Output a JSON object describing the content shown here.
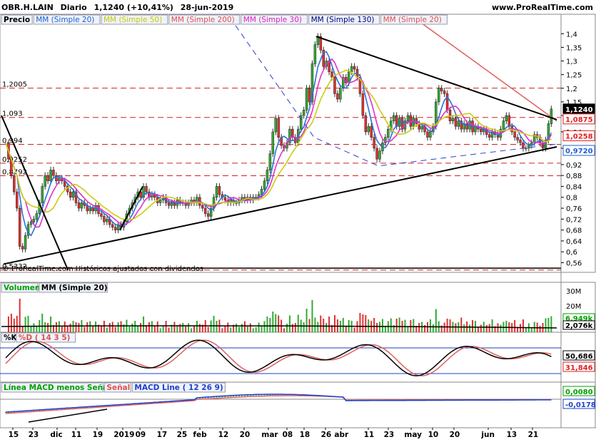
{
  "header": {
    "ticker": "OBR.H.LAIN",
    "period": "Diario",
    "last": "1,1240 (+10,41%)",
    "date": "28-jun-2019",
    "site": "www.ProRealTime.com"
  },
  "price_panel": {
    "legend": [
      {
        "label": "Precio",
        "color": "#000000"
      },
      {
        "label": "MM (Simple 20)",
        "color": "#1f5fd0"
      },
      {
        "label": "MM (Simple 50)",
        "color": "#c8c800"
      },
      {
        "label": "MM (Simple 200)",
        "color": "#e05050"
      },
      {
        "label": "MM (Simple 30)",
        "color": "#e020c0"
      },
      {
        "label": "MM (Simple 130)",
        "color": "#000080"
      },
      {
        "label": "MM (Simple 20)",
        "color": "#e05050"
      }
    ],
    "yticks": [
      "1,4",
      "1,35",
      "1,3",
      "1,25",
      "1,2",
      "1,15",
      "1,1",
      "1,04",
      "0,98",
      "0,92",
      "0,88",
      "0,84",
      "0,8",
      "0,76",
      "0,72",
      "0,68",
      "0,64",
      "0,6",
      "0,56"
    ],
    "hlines": [
      "1,2005",
      "1,093",
      "0,994",
      "0,9252",
      "0,8792",
      "0,5332"
    ],
    "right_labels": [
      {
        "text": "1,1240",
        "bg": "#000000",
        "fg": "#ffffff"
      },
      {
        "text": "1,0875",
        "bg": "#ffffff",
        "fg": "#e02020"
      },
      {
        "text": "1,0258",
        "bg": "#ffffff",
        "fg": "#e02020"
      },
      {
        "text": "0,9720",
        "bg": "#ffffff",
        "fg": "#1f5fd0"
      }
    ],
    "copyright": "© ProRealTime.com  Históricos ajustados con dividendos"
  },
  "volume_panel": {
    "legend": [
      {
        "label": "Volumen",
        "color": "#00a000"
      },
      {
        "label": "MM (Simple 20)",
        "color": "#000000"
      }
    ],
    "yticks": [
      "30M",
      "20M",
      "10M"
    ],
    "right_labels": [
      {
        "text": "6,949k",
        "fg": "#00a000"
      },
      {
        "text": "2,076k",
        "fg": "#000000"
      }
    ]
  },
  "stoch_panel": {
    "legend": [
      {
        "label": "%K",
        "color": "#000000"
      },
      {
        "label": "%D ( 14 3 5)",
        "color": "#e05050"
      }
    ],
    "right_labels": [
      {
        "text": "50,686",
        "fg": "#000000"
      },
      {
        "text": "31,846",
        "fg": "#e02020"
      }
    ]
  },
  "macd_panel": {
    "legend": [
      {
        "label": "Línea MACD menos Señal",
        "color": "#00a000"
      },
      {
        "label": "Señal",
        "color": "#e05050"
      },
      {
        "label": "MACD Line ( 12 26 9)",
        "color": "#1f3fd0"
      }
    ],
    "right_labels": [
      {
        "text": "0,0080",
        "fg": "#00a000"
      },
      {
        "text": "-0,0178",
        "fg": "#1f3fd0"
      }
    ]
  },
  "x_axis": {
    "labels": [
      "15",
      "23",
      "dic",
      "11",
      "19",
      "2019",
      "09",
      "17",
      "25",
      "feb",
      "12",
      "20",
      "mar",
      "08",
      "18",
      "26",
      "abr",
      "11",
      "23",
      "may",
      "10",
      "20",
      "jun",
      "13",
      "21"
    ]
  },
  "chart_data": {
    "type": "candlestick",
    "title": "OBR.H.LAIN Diario",
    "ylim": [
      0.53,
      1.44
    ],
    "hlines": [
      1.2005,
      1.093,
      0.994,
      0.9252,
      0.8792,
      0.5332
    ],
    "close_path": [
      [
        0,
        1.0
      ],
      [
        4,
        0.94
      ],
      [
        8,
        0.88
      ],
      [
        12,
        0.82
      ],
      [
        16,
        0.76
      ],
      [
        20,
        0.62
      ],
      [
        24,
        0.61
      ],
      [
        28,
        0.66
      ],
      [
        32,
        0.7
      ],
      [
        36,
        0.71
      ],
      [
        40,
        0.72
      ],
      [
        44,
        0.74
      ],
      [
        48,
        0.78
      ],
      [
        52,
        0.84
      ],
      [
        56,
        0.88
      ],
      [
        60,
        0.86
      ],
      [
        64,
        0.9
      ],
      [
        68,
        0.88
      ],
      [
        72,
        0.86
      ],
      [
        76,
        0.87
      ],
      [
        80,
        0.86
      ],
      [
        84,
        0.84
      ],
      [
        88,
        0.82
      ],
      [
        92,
        0.8
      ],
      [
        96,
        0.82
      ],
      [
        100,
        0.78
      ],
      [
        104,
        0.76
      ],
      [
        108,
        0.78
      ],
      [
        112,
        0.77
      ],
      [
        116,
        0.75
      ],
      [
        120,
        0.76
      ],
      [
        124,
        0.75
      ],
      [
        128,
        0.77
      ],
      [
        132,
        0.74
      ],
      [
        136,
        0.73
      ],
      [
        140,
        0.71
      ],
      [
        144,
        0.72
      ],
      [
        148,
        0.7
      ],
      [
        152,
        0.69
      ],
      [
        156,
        0.68
      ],
      [
        160,
        0.7
      ],
      [
        164,
        0.69
      ],
      [
        168,
        0.71
      ],
      [
        172,
        0.74
      ],
      [
        176,
        0.76
      ],
      [
        180,
        0.78
      ],
      [
        184,
        0.8
      ],
      [
        188,
        0.82
      ],
      [
        192,
        0.8
      ],
      [
        196,
        0.84
      ],
      [
        200,
        0.82
      ],
      [
        204,
        0.8
      ],
      [
        208,
        0.81
      ],
      [
        212,
        0.8
      ],
      [
        216,
        0.78
      ],
      [
        220,
        0.79
      ],
      [
        224,
        0.8
      ],
      [
        228,
        0.78
      ],
      [
        232,
        0.77
      ],
      [
        236,
        0.78
      ],
      [
        240,
        0.77
      ],
      [
        244,
        0.79
      ],
      [
        248,
        0.78
      ],
      [
        252,
        0.78
      ],
      [
        256,
        0.77
      ],
      [
        260,
        0.78
      ],
      [
        264,
        0.79
      ],
      [
        268,
        0.78
      ],
      [
        272,
        0.8
      ],
      [
        276,
        0.77
      ],
      [
        280,
        0.76
      ],
      [
        284,
        0.74
      ],
      [
        288,
        0.73
      ],
      [
        292,
        0.76
      ],
      [
        296,
        0.8
      ],
      [
        300,
        0.84
      ],
      [
        304,
        0.81
      ],
      [
        308,
        0.8
      ],
      [
        312,
        0.79
      ],
      [
        316,
        0.78
      ],
      [
        320,
        0.79
      ],
      [
        324,
        0.78
      ],
      [
        328,
        0.78
      ],
      [
        332,
        0.79
      ],
      [
        336,
        0.8
      ],
      [
        340,
        0.79
      ],
      [
        344,
        0.8
      ],
      [
        348,
        0.79
      ],
      [
        352,
        0.8
      ],
      [
        356,
        0.8
      ],
      [
        360,
        0.81
      ],
      [
        364,
        0.83
      ],
      [
        368,
        0.86
      ],
      [
        372,
        0.9
      ],
      [
        376,
        0.96
      ],
      [
        380,
        1.04
      ],
      [
        384,
        1.09
      ],
      [
        388,
        1.02
      ],
      [
        392,
        0.99
      ],
      [
        396,
        0.98
      ],
      [
        400,
        1.0
      ],
      [
        404,
        1.05
      ],
      [
        408,
        1.02
      ],
      [
        412,
        1.0
      ],
      [
        416,
        1.05
      ],
      [
        420,
        1.1
      ],
      [
        424,
        1.12
      ],
      [
        428,
        1.2
      ],
      [
        432,
        1.15
      ],
      [
        436,
        1.29
      ],
      [
        440,
        1.36
      ],
      [
        444,
        1.39
      ],
      [
        448,
        1.34
      ],
      [
        452,
        1.28
      ],
      [
        456,
        1.3
      ],
      [
        460,
        1.26
      ],
      [
        464,
        1.24
      ],
      [
        468,
        1.18
      ],
      [
        472,
        1.16
      ],
      [
        476,
        1.2
      ],
      [
        480,
        1.24
      ],
      [
        484,
        1.22
      ],
      [
        488,
        1.26
      ],
      [
        492,
        1.28
      ],
      [
        496,
        1.27
      ],
      [
        500,
        1.24
      ],
      [
        504,
        1.18
      ],
      [
        508,
        1.1
      ],
      [
        512,
        1.04
      ],
      [
        516,
        1.06
      ],
      [
        520,
        1.02
      ],
      [
        524,
        0.98
      ],
      [
        528,
        0.94
      ],
      [
        532,
        0.97
      ],
      [
        536,
        1.0
      ],
      [
        540,
        1.02
      ],
      [
        544,
        1.05
      ],
      [
        548,
        1.08
      ],
      [
        552,
        1.1
      ],
      [
        556,
        1.06
      ],
      [
        560,
        1.09
      ],
      [
        564,
        1.05
      ],
      [
        568,
        1.08
      ],
      [
        572,
        1.1
      ],
      [
        576,
        1.06
      ],
      [
        580,
        1.09
      ],
      [
        584,
        1.07
      ],
      [
        588,
        1.05
      ],
      [
        592,
        1.06
      ],
      [
        596,
        1.04
      ],
      [
        600,
        1.02
      ],
      [
        604,
        1.04
      ],
      [
        608,
        1.06
      ],
      [
        612,
        1.15
      ],
      [
        616,
        1.2
      ],
      [
        620,
        1.19
      ],
      [
        624,
        1.18
      ],
      [
        628,
        1.12
      ],
      [
        632,
        1.08
      ],
      [
        636,
        1.09
      ],
      [
        640,
        1.06
      ],
      [
        644,
        1.08
      ],
      [
        648,
        1.05
      ],
      [
        652,
        1.07
      ],
      [
        656,
        1.05
      ],
      [
        660,
        1.08
      ],
      [
        664,
        1.04
      ],
      [
        668,
        1.06
      ],
      [
        672,
        1.05
      ],
      [
        676,
        1.04
      ],
      [
        680,
        1.05
      ],
      [
        684,
        1.03
      ],
      [
        688,
        1.02
      ],
      [
        692,
        1.04
      ],
      [
        696,
        1.03
      ],
      [
        700,
        1.02
      ],
      [
        704,
        1.05
      ],
      [
        708,
        1.08
      ],
      [
        712,
        1.1
      ],
      [
        716,
        1.06
      ],
      [
        720,
        1.04
      ],
      [
        724,
        1.02
      ],
      [
        728,
        1.01
      ],
      [
        732,
        1.0
      ],
      [
        736,
        0.98
      ],
      [
        740,
        0.98
      ],
      [
        744,
        0.99
      ],
      [
        748,
        1.0
      ],
      [
        752,
        1.03
      ],
      [
        756,
        1.02
      ],
      [
        760,
        1.0
      ],
      [
        764,
        0.98
      ],
      [
        768,
        1.01
      ],
      [
        772,
        1.07
      ],
      [
        776,
        1.124
      ]
    ],
    "indicators": [
      "MM (Simple 20)",
      "MM (Simple 50)",
      "MM (Simple 200)",
      "MM (Simple 30)",
      "MM (Simple 130)",
      "MM (Simple 20)"
    ]
  },
  "colors": {
    "up": "#33aa33",
    "down": "#e03030",
    "hline": "#d02020",
    "grid_axis": "#000000",
    "ma20": "#2e6fd8",
    "ma50": "#cccc10",
    "ma200": "#e06060",
    "ma30": "#e030c8",
    "trend": "#000000",
    "dash_blue": "#2a3fd0"
  }
}
